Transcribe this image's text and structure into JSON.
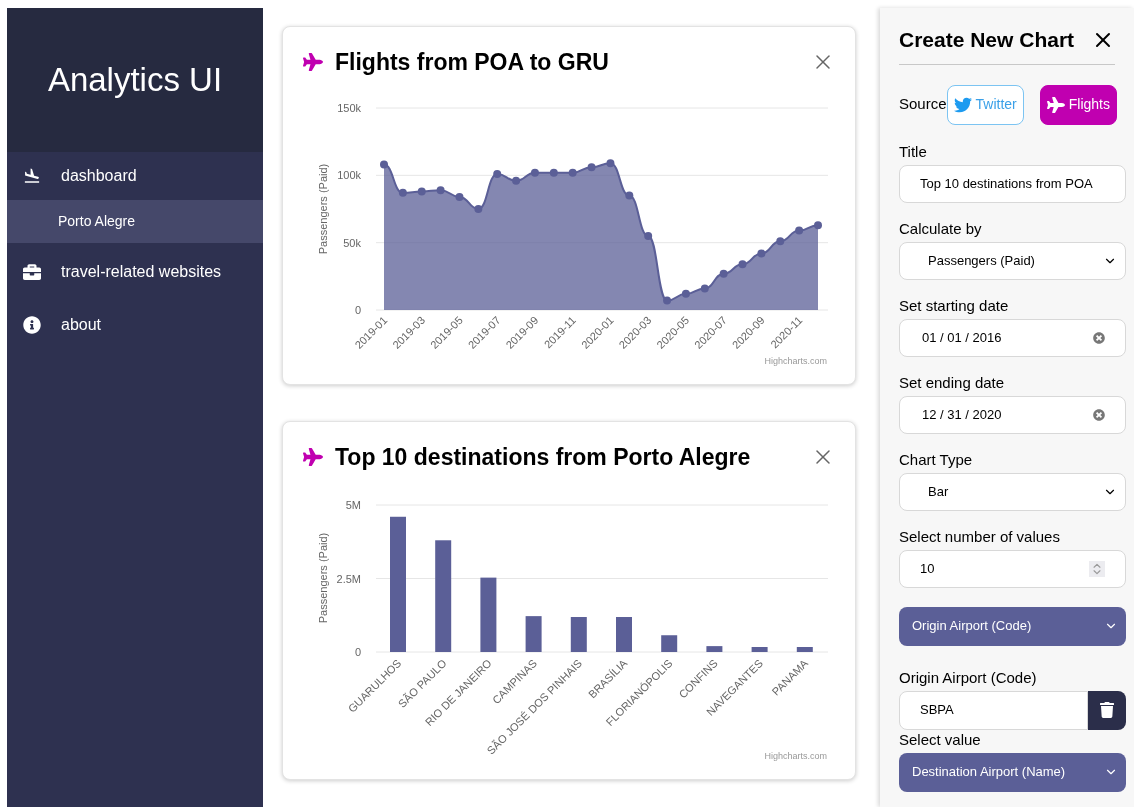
{
  "sidebar": {
    "title": "Analytics UI",
    "items": [
      {
        "label": "dashboard",
        "selected": false,
        "children": [
          {
            "label": "Porto Alegre",
            "selected": true
          }
        ]
      },
      {
        "label": "travel-related websites",
        "selected": false
      },
      {
        "label": "about",
        "selected": false
      }
    ]
  },
  "cards": [
    {
      "title": "Flights from POA to GRU",
      "credit": "Highcharts.com",
      "chart_data": {
        "type": "area",
        "ylabel": "Passengers (Paid)",
        "categories": [
          "2019-01",
          null,
          "2019-03",
          null,
          "2019-05",
          null,
          "2019-07",
          null,
          "2019-09",
          null,
          "2019-11",
          null,
          "2020-01",
          null,
          "2020-03",
          null,
          "2020-05",
          null,
          "2020-07",
          null,
          "2020-09",
          null,
          "2020-11",
          null
        ],
        "ylim": [
          0,
          150000
        ],
        "yticks": [
          {
            "value": 0,
            "label": "0"
          },
          {
            "value": 50000,
            "label": "50k"
          },
          {
            "value": 100000,
            "label": "100k"
          },
          {
            "value": 150000,
            "label": "150k"
          }
        ],
        "series": [
          {
            "color": "#5b5f97",
            "values": [
              108000,
              87000,
              88000,
              89000,
              84000,
              75000,
              101000,
              96000,
              102000,
              102000,
              102000,
              106000,
              109000,
              85000,
              55000,
              7000,
              12000,
              16000,
              27000,
              34000,
              42000,
              51000,
              59000,
              63000
            ]
          }
        ]
      }
    },
    {
      "title": "Top 10 destinations from Porto Alegre",
      "credit": "Highcharts.com",
      "chart_data": {
        "type": "bar",
        "ylabel": "Passengers (Paid)",
        "categories": [
          "GUARULHOS",
          "SÃO PAULO",
          "RIO DE JANEIRO",
          "CAMPINAS",
          "SÃO JOSÉ DOS PINHAIS",
          "BRASÍLIA",
          "FLORIANÓPOLIS",
          "CONFINS",
          "NAVEGANTES",
          "PANAMA"
        ],
        "ylim": [
          0,
          5000000
        ],
        "yticks": [
          {
            "value": 0,
            "label": "0"
          },
          {
            "value": 2500000,
            "label": "2.5M"
          },
          {
            "value": 5000000,
            "label": "5M"
          }
        ],
        "series": [
          {
            "color": "#5b5f97",
            "values": [
              4600000,
              3800000,
              2530000,
              1220000,
              1190000,
              1190000,
              570000,
              200000,
              170000,
              170000
            ]
          }
        ]
      }
    }
  ],
  "panel": {
    "title": "Create New Chart",
    "source_label": "Source",
    "sources": [
      {
        "label": "Twitter",
        "selected": false
      },
      {
        "label": "Flights",
        "selected": true
      }
    ],
    "fields": [
      {
        "kind": "text",
        "label": "Title",
        "value": "Top 10 destinations from POA"
      },
      {
        "kind": "select",
        "label": "Calculate by",
        "value": "Passengers (Paid)"
      },
      {
        "kind": "date",
        "label": "Set starting date",
        "value": "01 / 01 / 2016"
      },
      {
        "kind": "date",
        "label": "Set ending date",
        "value": "12 / 31 / 2020"
      },
      {
        "kind": "select",
        "label": "Chart Type",
        "value": "Bar"
      },
      {
        "kind": "number",
        "label": "Select number of values",
        "value": "10"
      },
      {
        "kind": "filter",
        "value": "Origin Airport (Code)"
      },
      {
        "kind": "removable",
        "label": "Origin Airport (Code)",
        "value": "SBPA"
      },
      {
        "kind": "filter",
        "label": "Select value",
        "value": "Destination Airport (Name)"
      }
    ]
  }
}
